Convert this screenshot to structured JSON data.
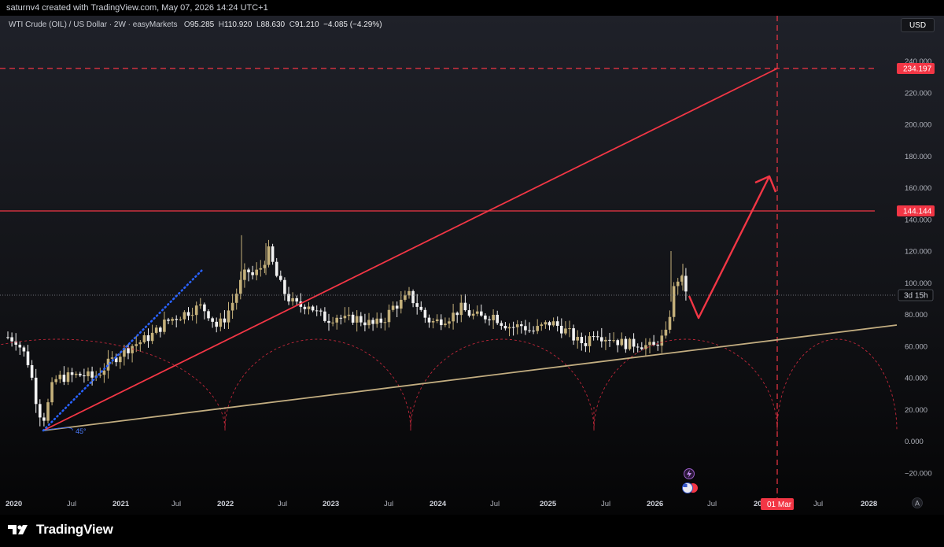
{
  "header": {
    "attribution": "saturnv4 created with TradingView.com, May 07, 2026 14:24 UTC+1"
  },
  "legend": {
    "symbol": "WTI Crude (OIL) / US Dollar · 2W · easyMarkets",
    "open_label": "O",
    "open": "95.285",
    "high_label": "H",
    "high": "110.920",
    "low_label": "L",
    "low": "88.630",
    "close_label": "C",
    "close": "91.210",
    "change": "−4.085 (−4.29%)"
  },
  "currency_button": "USD",
  "price_axis": {
    "ticks": [
      "240.000",
      "220.000",
      "200.000",
      "180.000",
      "160.000",
      "140.000",
      "120.000",
      "100.000",
      "80.000",
      "60.000",
      "40.000",
      "20.000",
      "0.000",
      "−20.000"
    ],
    "target_label": "234.197",
    "level_label": "144.144",
    "countdown": "3d 15h"
  },
  "time_axis": {
    "ticks": [
      {
        "t": "2020",
        "year": true
      },
      {
        "t": "Jul",
        "year": false
      },
      {
        "t": "2021",
        "year": true
      },
      {
        "t": "Jul",
        "year": false
      },
      {
        "t": "2022",
        "year": true
      },
      {
        "t": "Jul",
        "year": false
      },
      {
        "t": "2023",
        "year": true
      },
      {
        "t": "Jul",
        "year": false
      },
      {
        "t": "2024",
        "year": true
      },
      {
        "t": "Jul",
        "year": false
      },
      {
        "t": "2025",
        "year": true
      },
      {
        "t": "Jul",
        "year": false
      },
      {
        "t": "2026",
        "year": true
      },
      {
        "t": "Jul",
        "year": false
      },
      {
        "t": "20",
        "year": true
      },
      {
        "t": "Jul",
        "year": false
      },
      {
        "t": "2028",
        "year": true
      }
    ],
    "cursor_label": "01 Mar",
    "auto_button": "A"
  },
  "drawings": {
    "angle_label": "45°"
  },
  "footer": {
    "brand": "TradingView"
  },
  "colors": {
    "bull": "#c4b07a",
    "bear": "#f2f2f2",
    "drawing_red": "#f23645",
    "trendline": "#c2ad80",
    "dotted_blue": "#2962ff"
  }
}
